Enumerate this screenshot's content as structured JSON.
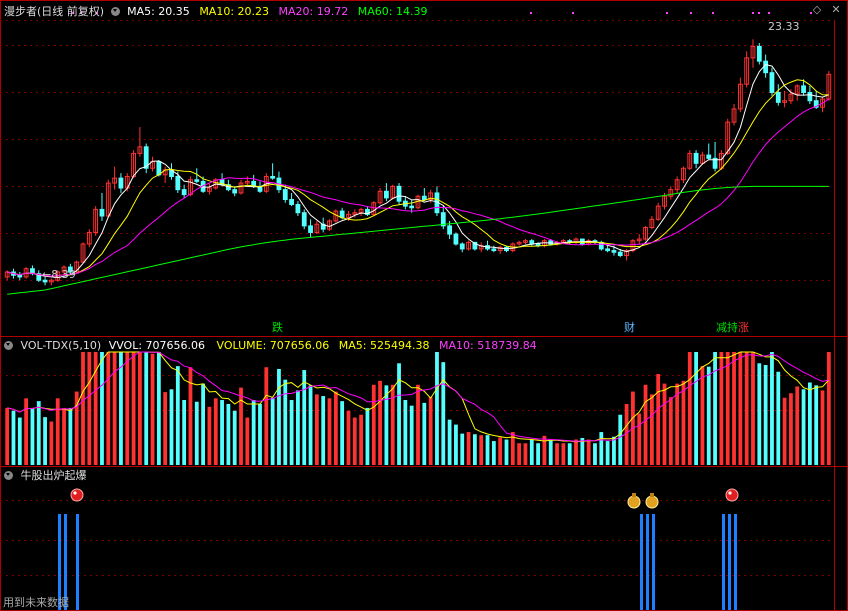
{
  "main_header": {
    "title": "漫步者(日线 前复权)",
    "ma5": "MA5: 20.35",
    "ma10": "MA10: 20.23",
    "ma20": "MA20: 19.72",
    "ma60": "MA60: 14.39"
  },
  "annotations": {
    "high_price": "23.33",
    "low_price": "←8.39",
    "event_fall": "跌",
    "event_finance": "财",
    "event_holding": "减持",
    "event_rise": "涨"
  },
  "volume_header": {
    "indicator": "VOL-TDX(5,10)",
    "vvol": "VVOL: 707656.06",
    "volume": "VOLUME: 707656.06",
    "ma5": "MA5: 525494.38",
    "ma10": "MA10: 518739.84"
  },
  "signal_header": {
    "indicator": "牛股出炉起爆",
    "footer_note": "用到未来数据"
  },
  "colors": {
    "up": "#ff3232",
    "down": "#54ffff",
    "ma5": "#ffffff",
    "ma10": "#ffff00",
    "ma20": "#ff00ff",
    "ma60": "#00ff00",
    "signal_bar": "#1e7fff",
    "panel_border": "#b00000",
    "grid": "#7a0000"
  },
  "chart_data": [
    {
      "type": "candlestick",
      "title": "漫步者(日线 前复权)",
      "ylim": [
        7.5,
        24.5
      ],
      "series_names": [
        "MA5",
        "MA10",
        "MA20",
        "MA60"
      ],
      "visible_high": 23.33,
      "visible_low": 8.39,
      "candles_ohlc": [
        [
          8.9,
          9.3,
          8.7,
          9.2
        ],
        [
          9.2,
          9.4,
          8.8,
          9.0
        ],
        [
          9.0,
          9.2,
          8.7,
          8.9
        ],
        [
          8.9,
          9.5,
          8.8,
          9.4
        ],
        [
          9.4,
          9.6,
          9.0,
          9.1
        ],
        [
          9.1,
          9.3,
          8.6,
          8.7
        ],
        [
          8.7,
          8.9,
          8.39,
          8.6
        ],
        [
          8.6,
          8.8,
          8.4,
          8.7
        ],
        [
          8.7,
          9.3,
          8.6,
          9.2
        ],
        [
          9.2,
          9.6,
          9.0,
          9.5
        ],
        [
          9.5,
          9.7,
          9.1,
          9.2
        ],
        [
          9.2,
          9.9,
          9.1,
          9.8
        ],
        [
          9.8,
          11.0,
          9.7,
          10.9
        ],
        [
          10.9,
          11.8,
          10.7,
          11.6
        ],
        [
          11.6,
          13.2,
          11.4,
          13.0
        ],
        [
          13.0,
          14.0,
          12.3,
          12.6
        ],
        [
          12.6,
          14.8,
          12.5,
          14.6
        ],
        [
          14.6,
          15.6,
          14.2,
          14.9
        ],
        [
          14.9,
          15.2,
          14.0,
          14.3
        ],
        [
          14.3,
          15.2,
          14.1,
          15.0
        ],
        [
          15.0,
          16.6,
          14.9,
          16.4
        ],
        [
          16.4,
          18.0,
          16.2,
          16.8
        ],
        [
          16.8,
          17.0,
          15.2,
          15.5
        ],
        [
          15.5,
          16.2,
          15.3,
          15.9
        ],
        [
          15.9,
          16.0,
          15.0,
          15.1
        ],
        [
          15.1,
          15.6,
          14.6,
          15.4
        ],
        [
          15.4,
          15.8,
          14.8,
          15.0
        ],
        [
          15.0,
          15.3,
          14.0,
          14.2
        ],
        [
          14.2,
          14.5,
          13.7,
          13.9
        ],
        [
          13.9,
          15.0,
          13.8,
          14.8
        ],
        [
          14.8,
          15.5,
          14.6,
          14.7
        ],
        [
          14.7,
          15.0,
          14.0,
          14.1
        ],
        [
          14.1,
          14.6,
          13.9,
          14.3
        ],
        [
          14.3,
          14.9,
          14.2,
          14.8
        ],
        [
          14.8,
          15.2,
          14.4,
          14.5
        ],
        [
          14.5,
          14.8,
          14.1,
          14.2
        ],
        [
          14.2,
          14.4,
          13.8,
          14.0
        ],
        [
          14.0,
          14.8,
          13.9,
          14.6
        ],
        [
          14.6,
          15.0,
          14.5,
          14.7
        ],
        [
          14.7,
          15.1,
          14.3,
          14.4
        ],
        [
          14.4,
          14.7,
          14.0,
          14.1
        ],
        [
          14.1,
          15.2,
          14.0,
          15.0
        ],
        [
          15.0,
          15.8,
          14.8,
          14.9
        ],
        [
          14.9,
          15.3,
          14.0,
          14.2
        ],
        [
          14.2,
          14.5,
          13.4,
          13.6
        ],
        [
          13.6,
          14.0,
          13.2,
          13.3
        ],
        [
          13.3,
          13.5,
          12.6,
          12.8
        ],
        [
          12.8,
          13.0,
          11.8,
          12.0
        ],
        [
          12.0,
          12.4,
          11.3,
          11.6
        ],
        [
          11.6,
          12.3,
          11.5,
          12.1
        ],
        [
          12.1,
          12.5,
          11.6,
          11.8
        ],
        [
          11.8,
          12.4,
          11.7,
          12.3
        ],
        [
          12.3,
          13.0,
          12.2,
          12.9
        ],
        [
          12.9,
          13.1,
          12.4,
          12.5
        ],
        [
          12.5,
          12.9,
          12.3,
          12.7
        ],
        [
          12.7,
          13.0,
          12.5,
          12.8
        ],
        [
          12.8,
          13.1,
          12.6,
          13.0
        ],
        [
          13.0,
          13.2,
          12.6,
          12.7
        ],
        [
          12.7,
          13.5,
          12.6,
          13.4
        ],
        [
          13.4,
          14.3,
          13.3,
          14.1
        ],
        [
          14.1,
          14.6,
          13.5,
          13.7
        ],
        [
          13.7,
          14.5,
          13.6,
          14.4
        ],
        [
          14.4,
          14.6,
          13.3,
          13.5
        ],
        [
          13.5,
          13.8,
          13.0,
          13.2
        ],
        [
          13.2,
          13.6,
          12.8,
          13.1
        ],
        [
          13.1,
          13.9,
          13.0,
          13.8
        ],
        [
          13.8,
          14.3,
          13.5,
          13.6
        ],
        [
          13.6,
          14.2,
          13.4,
          14.0
        ],
        [
          14.0,
          14.4,
          12.6,
          12.8
        ],
        [
          12.8,
          13.2,
          11.8,
          12.0
        ],
        [
          12.0,
          12.3,
          11.2,
          11.5
        ],
        [
          11.5,
          11.6,
          10.8,
          10.9
        ],
        [
          10.9,
          11.0,
          10.4,
          10.6
        ],
        [
          10.6,
          11.1,
          10.5,
          11.0
        ],
        [
          11.0,
          11.0,
          10.5,
          10.6
        ],
        [
          10.6,
          11.0,
          10.4,
          10.8
        ],
        [
          10.8,
          11.1,
          10.5,
          10.6
        ],
        [
          10.6,
          10.8,
          10.4,
          10.5
        ],
        [
          10.5,
          10.8,
          10.3,
          10.7
        ],
        [
          10.7,
          10.8,
          10.4,
          10.5
        ],
        [
          10.5,
          11.0,
          10.4,
          10.9
        ],
        [
          10.9,
          11.1,
          10.8,
          11.0
        ],
        [
          11.0,
          11.2,
          10.9,
          11.1
        ],
        [
          11.1,
          11.2,
          10.8,
          10.9
        ],
        [
          10.9,
          11.0,
          10.7,
          10.8
        ],
        [
          10.8,
          11.2,
          10.7,
          11.1
        ],
        [
          11.1,
          11.2,
          10.8,
          10.9
        ],
        [
          10.9,
          11.1,
          10.8,
          11.0
        ],
        [
          11.0,
          11.2,
          10.9,
          11.1
        ],
        [
          11.1,
          11.2,
          10.9,
          11.0
        ],
        [
          11.0,
          11.3,
          10.9,
          11.2
        ],
        [
          11.2,
          11.2,
          10.8,
          10.9
        ],
        [
          10.9,
          11.2,
          10.8,
          11.1
        ],
        [
          11.1,
          11.2,
          10.9,
          11.0
        ],
        [
          11.0,
          11.1,
          10.5,
          10.6
        ],
        [
          10.6,
          10.8,
          10.4,
          10.5
        ],
        [
          10.5,
          10.8,
          10.2,
          10.4
        ],
        [
          10.4,
          10.6,
          10.1,
          10.2
        ],
        [
          10.2,
          10.6,
          9.9,
          10.5
        ],
        [
          10.5,
          11.2,
          10.4,
          11.1
        ],
        [
          11.1,
          11.5,
          10.9,
          11.2
        ],
        [
          11.2,
          12.0,
          11.1,
          11.9
        ],
        [
          11.9,
          12.6,
          11.8,
          12.4
        ],
        [
          12.4,
          13.4,
          12.3,
          13.2
        ],
        [
          13.2,
          14.0,
          13.0,
          13.8
        ],
        [
          13.8,
          14.4,
          13.6,
          14.2
        ],
        [
          14.2,
          15.0,
          14.0,
          14.8
        ],
        [
          14.8,
          15.6,
          14.6,
          15.5
        ],
        [
          15.5,
          16.6,
          15.4,
          16.4
        ],
        [
          16.4,
          16.6,
          15.5,
          15.8
        ],
        [
          15.8,
          16.5,
          15.7,
          16.3
        ],
        [
          16.3,
          17.0,
          16.0,
          16.1
        ],
        [
          16.1,
          17.1,
          15.3,
          15.5
        ],
        [
          15.5,
          16.6,
          15.4,
          16.4
        ],
        [
          16.4,
          18.5,
          16.3,
          18.3
        ],
        [
          18.3,
          19.4,
          18.1,
          19.1
        ],
        [
          19.1,
          21.0,
          18.9,
          20.6
        ],
        [
          20.6,
          22.6,
          20.4,
          22.2
        ],
        [
          22.2,
          23.33,
          21.6,
          22.9
        ],
        [
          22.9,
          23.1,
          21.8,
          22.0
        ],
        [
          22.0,
          22.4,
          21.0,
          21.3
        ],
        [
          21.3,
          21.6,
          19.9,
          20.1
        ],
        [
          20.1,
          20.6,
          19.3,
          19.5
        ],
        [
          19.5,
          20.2,
          19.2,
          19.6
        ],
        [
          19.6,
          20.3,
          19.4,
          20.0
        ],
        [
          20.0,
          20.6,
          19.6,
          20.5
        ],
        [
          20.5,
          20.9,
          19.9,
          20.1
        ],
        [
          20.1,
          20.5,
          19.4,
          19.6
        ],
        [
          19.6,
          20.2,
          19.1,
          19.2
        ],
        [
          19.2,
          19.8,
          18.9,
          19.7
        ],
        [
          19.7,
          21.4,
          19.6,
          21.2
        ]
      ],
      "ma60_values": [
        [
          0,
          7.6
        ],
        [
          40,
          11.0
        ],
        [
          80,
          12.5
        ],
        [
          100,
          13.6
        ],
        [
          113,
          14.4
        ]
      ]
    },
    {
      "type": "bar",
      "title": "VOL-TDX(5,10)",
      "last_volume": 707656.06,
      "ma5": 525494.38,
      "ma10": 518739.84
    },
    {
      "type": "bar",
      "title": "牛股出炉起爆",
      "signal_groups": [
        {
          "indices": [
            5,
            6,
            8
          ],
          "icon": "red-ball"
        },
        {
          "indices": [
            88,
            89,
            90
          ],
          "icon": "money-bag"
        },
        {
          "indices": [
            99,
            100,
            101
          ],
          "icon": "red-ball"
        }
      ]
    }
  ]
}
